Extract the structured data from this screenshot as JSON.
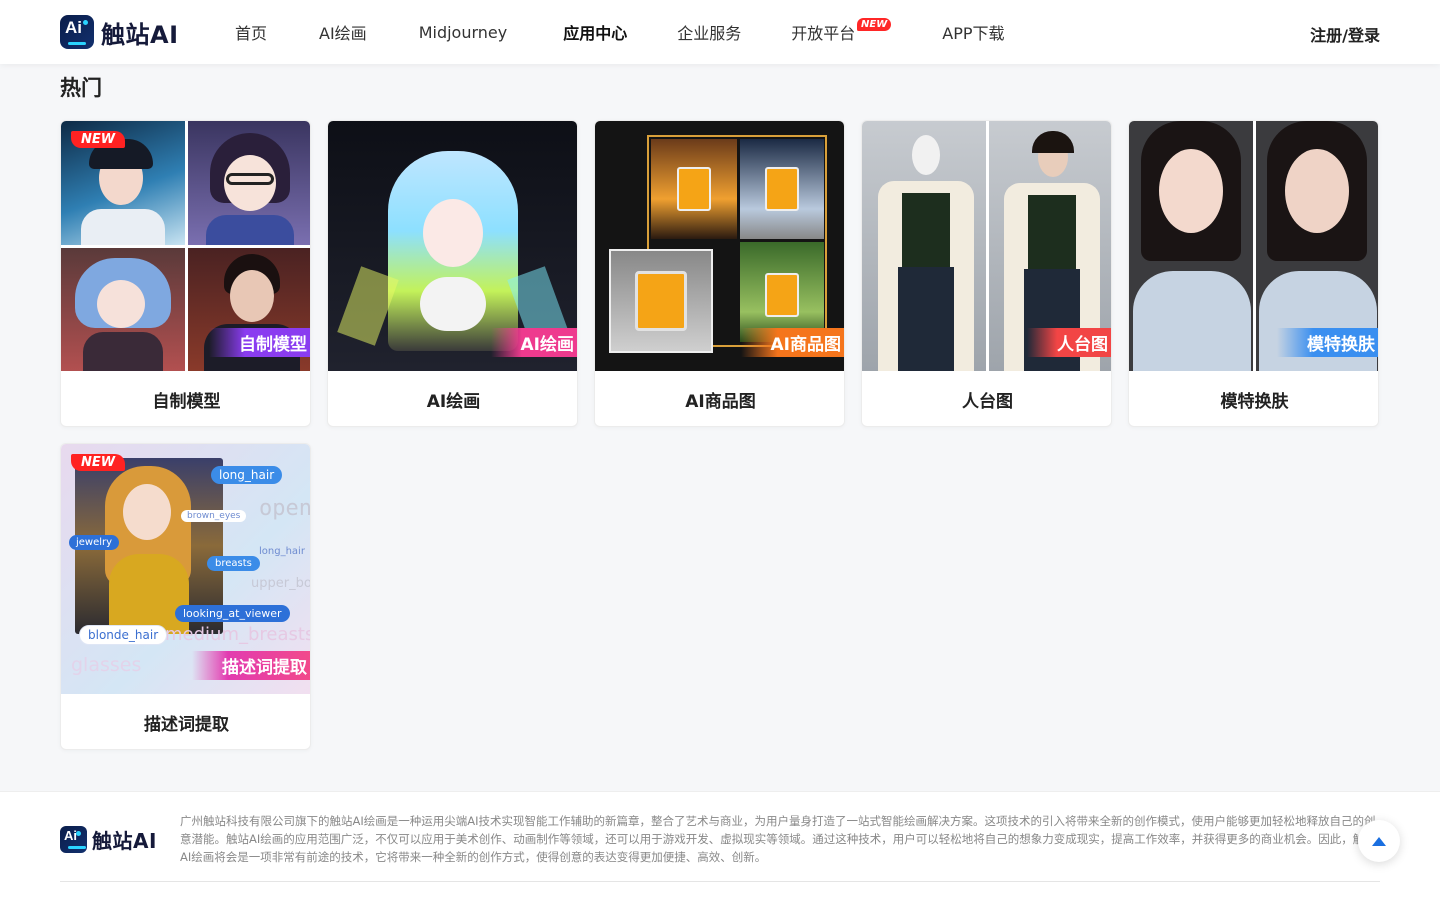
{
  "header": {
    "brand": "触站AI",
    "logo_mark": "Ai",
    "nav": [
      {
        "label": "首页"
      },
      {
        "label": "AI绘画"
      },
      {
        "label": "Midjourney"
      },
      {
        "label": "应用中心"
      },
      {
        "label": "企业服务"
      },
      {
        "label": "开放平台",
        "badge": "NEW"
      },
      {
        "label": "APP下载"
      }
    ],
    "login": "注册/登录"
  },
  "section": {
    "title": "热门",
    "cards": [
      {
        "label": "自制模型",
        "tag": "自制模型",
        "new": "NEW",
        "tag_color": "#8a3cf0"
      },
      {
        "label": "AI绘画",
        "tag": "AI绘画",
        "tag_color": "#ee3a8e"
      },
      {
        "label": "AI商品图",
        "tag": "AI商品图",
        "tag_color": "#f5751c"
      },
      {
        "label": "人台图",
        "tag": "人台图",
        "tag_color": "#f24545"
      },
      {
        "label": "模特换肤",
        "tag": "模特换肤",
        "tag_color": "#3a8ff0"
      },
      {
        "label": "描述词提取",
        "tag": "描述词提取",
        "new": "NEW",
        "tag_color": "#e23bb0",
        "chips": [
          "long_hair",
          "brown_eyes",
          "jewelry",
          "long_hair",
          "breasts",
          "looking_at_viewer",
          "blonde_hair"
        ],
        "ghost_words": [
          "open",
          "upper_body",
          "medium_breasts",
          "glasses"
        ]
      }
    ]
  },
  "footer": {
    "brand": "触站AI",
    "logo_mark": "Ai",
    "text": "广州触站科技有限公司旗下的触站AI绘画是一种运用尖端AI技术实现智能工作辅助的新篇章，整合了艺术与商业，为用户量身打造了一站式智能绘画解决方案。这项技术的引入将带来全新的创作模式，使用户能够更加轻松地释放自己的创意潜能。触站AI绘画的应用范围广泛，不仅可以应用于美术创作、动画制作等领域，还可以用于游戏开发、虚拟现实等领域。通过这种技术，用户可以轻松地将自己的想象力变成现实，提高工作效率，并获得更多的商业机会。因此，触站AI绘画将会是一项非常有前途的技术，它将带来一种全新的创作方式，使得创意的表达变得更加便捷、高效、创新。"
  },
  "colors": {
    "accent": "#1a6fe0",
    "badge_red": "#ff2222"
  }
}
